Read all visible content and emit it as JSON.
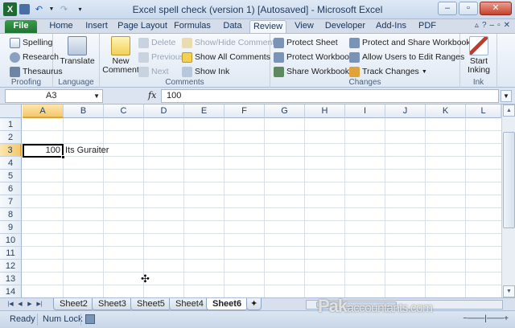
{
  "window": {
    "title": "Excel spell check (version 1) [Autosaved]  -  Microsoft Excel"
  },
  "tabs": [
    "File",
    "Home",
    "Insert",
    "Page Layout",
    "Formulas",
    "Data",
    "Review",
    "View",
    "Developer",
    "Add-Ins",
    "PDF"
  ],
  "active_tab": "Review",
  "ribbon": {
    "proofing": {
      "label": "Proofing",
      "spelling": "Spelling",
      "research": "Research",
      "thesaurus": "Thesaurus"
    },
    "language": {
      "label": "Language",
      "translate": "Translate"
    },
    "comments": {
      "label": "Comments",
      "new_comment_line1": "New",
      "new_comment_line2": "Comment",
      "delete": "Delete",
      "previous": "Previous",
      "next": "Next",
      "show_hide": "Show/Hide Comment",
      "show_all": "Show All Comments",
      "show_ink": "Show Ink"
    },
    "changes": {
      "label": "Changes",
      "protect_sheet": "Protect Sheet",
      "protect_workbook": "Protect Workbook",
      "share_workbook": "Share Workbook",
      "protect_share": "Protect and Share Workbook",
      "allow_users": "Allow Users to Edit Ranges",
      "track_changes": "Track Changes"
    },
    "ink": {
      "label": "Ink",
      "start_line1": "Start",
      "start_line2": "Inking"
    }
  },
  "formula_bar": {
    "name_box": "A3",
    "fx": "fx",
    "content": "100"
  },
  "columns": [
    "A",
    "B",
    "C",
    "D",
    "E",
    "F",
    "G",
    "H",
    "I",
    "J",
    "K",
    "L"
  ],
  "selected_column": "A",
  "rows": [
    "1",
    "2",
    "3",
    "4",
    "5",
    "6",
    "7",
    "8",
    "9",
    "10",
    "11",
    "12",
    "13",
    "14"
  ],
  "selected_row": "3",
  "cells": {
    "A3": "100",
    "B3": "Its Guraiter"
  },
  "sheets": [
    "Sheet2",
    "Sheet3",
    "Sheet5",
    "Sheet4",
    "Sheet6"
  ],
  "active_sheet": "Sheet6",
  "status": {
    "ready": "Ready",
    "num_lock": "Num Lock"
  },
  "watermark": {
    "part1": "Pak",
    "part2": "accountants.com"
  },
  "colors": {
    "accent": "#1d6b33",
    "selection": "#f5c86c",
    "ribbon": "#dfe8f3"
  }
}
